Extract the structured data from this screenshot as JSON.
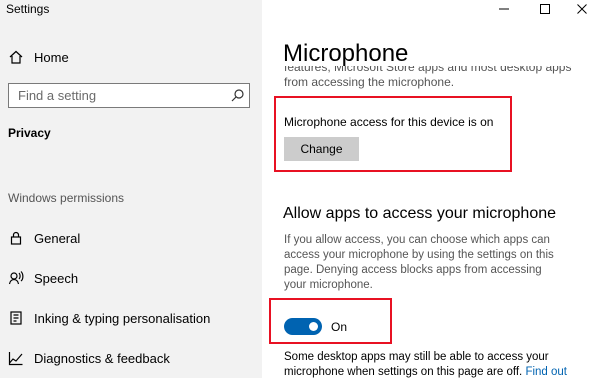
{
  "window": {
    "app_title": "Settings",
    "controls": [
      "minimize-icon",
      "maximize-icon",
      "close-icon"
    ]
  },
  "sidebar": {
    "home_label": "Home",
    "search_placeholder": "Find a setting",
    "current_section": "Privacy",
    "group_heading": "Windows permissions",
    "items": [
      {
        "label": "General",
        "icon": "lock-icon"
      },
      {
        "label": "Speech",
        "icon": "speech-icon"
      },
      {
        "label": "Inking & typing personalisation",
        "icon": "inking-icon"
      },
      {
        "label": "Diagnostics & feedback",
        "icon": "diagnostics-icon"
      }
    ]
  },
  "main": {
    "page_title": "Microphone",
    "cut_line_1": "features, Microsoft Store apps and most desktop apps",
    "cut_line_2": "from accessing the microphone.",
    "device_status": "Microphone access for this device is on",
    "change_button": "Change",
    "section_title": "Allow apps to access your microphone",
    "section_desc": "If you allow access, you can choose which apps can access your microphone by using the settings on this page. Denying access blocks apps from accessing your microphone.",
    "toggle_state": "On",
    "note_text": "Some desktop apps may still be able to access your microphone when settings on this page are off.",
    "note_link": "Find out"
  },
  "colors": {
    "accent": "#0063b1",
    "highlight": "#e81123",
    "sidebar_bg": "#f2f2f2"
  }
}
